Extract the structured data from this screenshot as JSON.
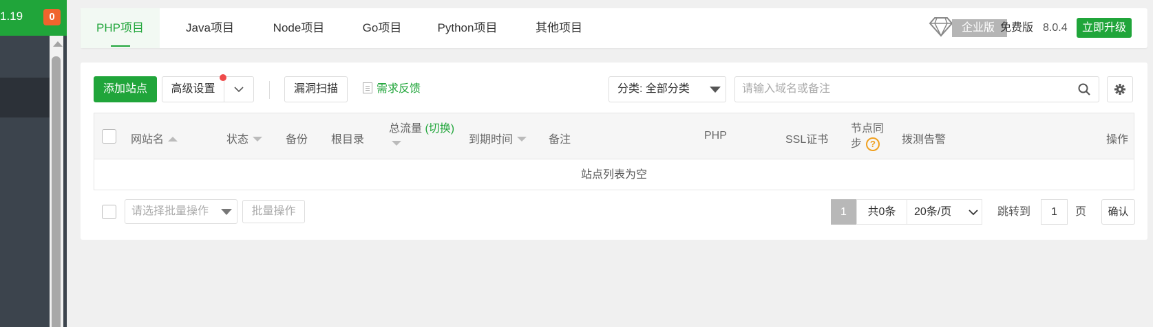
{
  "sidebar": {
    "version": "1.19",
    "badge_count": "0"
  },
  "tabs": [
    {
      "label": "PHP项目",
      "active": true
    },
    {
      "label": "Java项目"
    },
    {
      "label": "Node项目"
    },
    {
      "label": "Go项目"
    },
    {
      "label": "Python项目"
    },
    {
      "label": "其他项目"
    }
  ],
  "edition": {
    "enterprise": "企业版",
    "free": "免费版",
    "version": "8.0.4",
    "upgrade": "立即升级"
  },
  "toolbar": {
    "add_site": "添加站点",
    "advanced": "高级设置",
    "vuln_scan": "漏洞扫描",
    "feedback": "需求反馈",
    "category": "分类: 全部分类",
    "search_placeholder": "请输入域名或备注"
  },
  "table": {
    "headers": {
      "site_name": "网站名",
      "status": "状态",
      "backup": "备份",
      "root_dir": "根目录",
      "traffic": "总流量",
      "traffic_switch": "(切换)",
      "expire": "到期时间",
      "note": "备注",
      "php": "PHP",
      "ssl": "SSL证书",
      "node_sync_1": "节点同",
      "node_sync_2": "步",
      "dial_alert": "拨测告警",
      "actions": "操作"
    },
    "empty_text": "站点列表为空"
  },
  "footer": {
    "batch_placeholder": "请选择批量操作",
    "batch_button": "批量操作",
    "current_page": "1",
    "total": "共0条",
    "per_page": "20条/页",
    "goto_label": "跳转到",
    "goto_value": "1",
    "page_unit": "页",
    "confirm": "确认"
  },
  "colors": {
    "accent": "#20a53a",
    "badge": "#f0642d",
    "sidebar": "#3c444d"
  }
}
